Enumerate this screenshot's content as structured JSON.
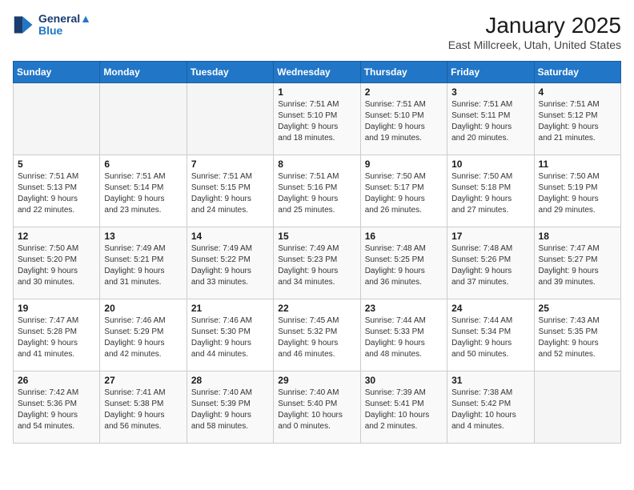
{
  "logo": {
    "line1": "General",
    "line2": "Blue"
  },
  "title": "January 2025",
  "subtitle": "East Millcreek, Utah, United States",
  "weekdays": [
    "Sunday",
    "Monday",
    "Tuesday",
    "Wednesday",
    "Thursday",
    "Friday",
    "Saturday"
  ],
  "weeks": [
    [
      {
        "day": "",
        "info": ""
      },
      {
        "day": "",
        "info": ""
      },
      {
        "day": "",
        "info": ""
      },
      {
        "day": "1",
        "info": "Sunrise: 7:51 AM\nSunset: 5:10 PM\nDaylight: 9 hours\nand 18 minutes."
      },
      {
        "day": "2",
        "info": "Sunrise: 7:51 AM\nSunset: 5:10 PM\nDaylight: 9 hours\nand 19 minutes."
      },
      {
        "day": "3",
        "info": "Sunrise: 7:51 AM\nSunset: 5:11 PM\nDaylight: 9 hours\nand 20 minutes."
      },
      {
        "day": "4",
        "info": "Sunrise: 7:51 AM\nSunset: 5:12 PM\nDaylight: 9 hours\nand 21 minutes."
      }
    ],
    [
      {
        "day": "5",
        "info": "Sunrise: 7:51 AM\nSunset: 5:13 PM\nDaylight: 9 hours\nand 22 minutes."
      },
      {
        "day": "6",
        "info": "Sunrise: 7:51 AM\nSunset: 5:14 PM\nDaylight: 9 hours\nand 23 minutes."
      },
      {
        "day": "7",
        "info": "Sunrise: 7:51 AM\nSunset: 5:15 PM\nDaylight: 9 hours\nand 24 minutes."
      },
      {
        "day": "8",
        "info": "Sunrise: 7:51 AM\nSunset: 5:16 PM\nDaylight: 9 hours\nand 25 minutes."
      },
      {
        "day": "9",
        "info": "Sunrise: 7:50 AM\nSunset: 5:17 PM\nDaylight: 9 hours\nand 26 minutes."
      },
      {
        "day": "10",
        "info": "Sunrise: 7:50 AM\nSunset: 5:18 PM\nDaylight: 9 hours\nand 27 minutes."
      },
      {
        "day": "11",
        "info": "Sunrise: 7:50 AM\nSunset: 5:19 PM\nDaylight: 9 hours\nand 29 minutes."
      }
    ],
    [
      {
        "day": "12",
        "info": "Sunrise: 7:50 AM\nSunset: 5:20 PM\nDaylight: 9 hours\nand 30 minutes."
      },
      {
        "day": "13",
        "info": "Sunrise: 7:49 AM\nSunset: 5:21 PM\nDaylight: 9 hours\nand 31 minutes."
      },
      {
        "day": "14",
        "info": "Sunrise: 7:49 AM\nSunset: 5:22 PM\nDaylight: 9 hours\nand 33 minutes."
      },
      {
        "day": "15",
        "info": "Sunrise: 7:49 AM\nSunset: 5:23 PM\nDaylight: 9 hours\nand 34 minutes."
      },
      {
        "day": "16",
        "info": "Sunrise: 7:48 AM\nSunset: 5:25 PM\nDaylight: 9 hours\nand 36 minutes."
      },
      {
        "day": "17",
        "info": "Sunrise: 7:48 AM\nSunset: 5:26 PM\nDaylight: 9 hours\nand 37 minutes."
      },
      {
        "day": "18",
        "info": "Sunrise: 7:47 AM\nSunset: 5:27 PM\nDaylight: 9 hours\nand 39 minutes."
      }
    ],
    [
      {
        "day": "19",
        "info": "Sunrise: 7:47 AM\nSunset: 5:28 PM\nDaylight: 9 hours\nand 41 minutes."
      },
      {
        "day": "20",
        "info": "Sunrise: 7:46 AM\nSunset: 5:29 PM\nDaylight: 9 hours\nand 42 minutes."
      },
      {
        "day": "21",
        "info": "Sunrise: 7:46 AM\nSunset: 5:30 PM\nDaylight: 9 hours\nand 44 minutes."
      },
      {
        "day": "22",
        "info": "Sunrise: 7:45 AM\nSunset: 5:32 PM\nDaylight: 9 hours\nand 46 minutes."
      },
      {
        "day": "23",
        "info": "Sunrise: 7:44 AM\nSunset: 5:33 PM\nDaylight: 9 hours\nand 48 minutes."
      },
      {
        "day": "24",
        "info": "Sunrise: 7:44 AM\nSunset: 5:34 PM\nDaylight: 9 hours\nand 50 minutes."
      },
      {
        "day": "25",
        "info": "Sunrise: 7:43 AM\nSunset: 5:35 PM\nDaylight: 9 hours\nand 52 minutes."
      }
    ],
    [
      {
        "day": "26",
        "info": "Sunrise: 7:42 AM\nSunset: 5:36 PM\nDaylight: 9 hours\nand 54 minutes."
      },
      {
        "day": "27",
        "info": "Sunrise: 7:41 AM\nSunset: 5:38 PM\nDaylight: 9 hours\nand 56 minutes."
      },
      {
        "day": "28",
        "info": "Sunrise: 7:40 AM\nSunset: 5:39 PM\nDaylight: 9 hours\nand 58 minutes."
      },
      {
        "day": "29",
        "info": "Sunrise: 7:40 AM\nSunset: 5:40 PM\nDaylight: 10 hours\nand 0 minutes."
      },
      {
        "day": "30",
        "info": "Sunrise: 7:39 AM\nSunset: 5:41 PM\nDaylight: 10 hours\nand 2 minutes."
      },
      {
        "day": "31",
        "info": "Sunrise: 7:38 AM\nSunset: 5:42 PM\nDaylight: 10 hours\nand 4 minutes."
      },
      {
        "day": "",
        "info": ""
      }
    ]
  ]
}
